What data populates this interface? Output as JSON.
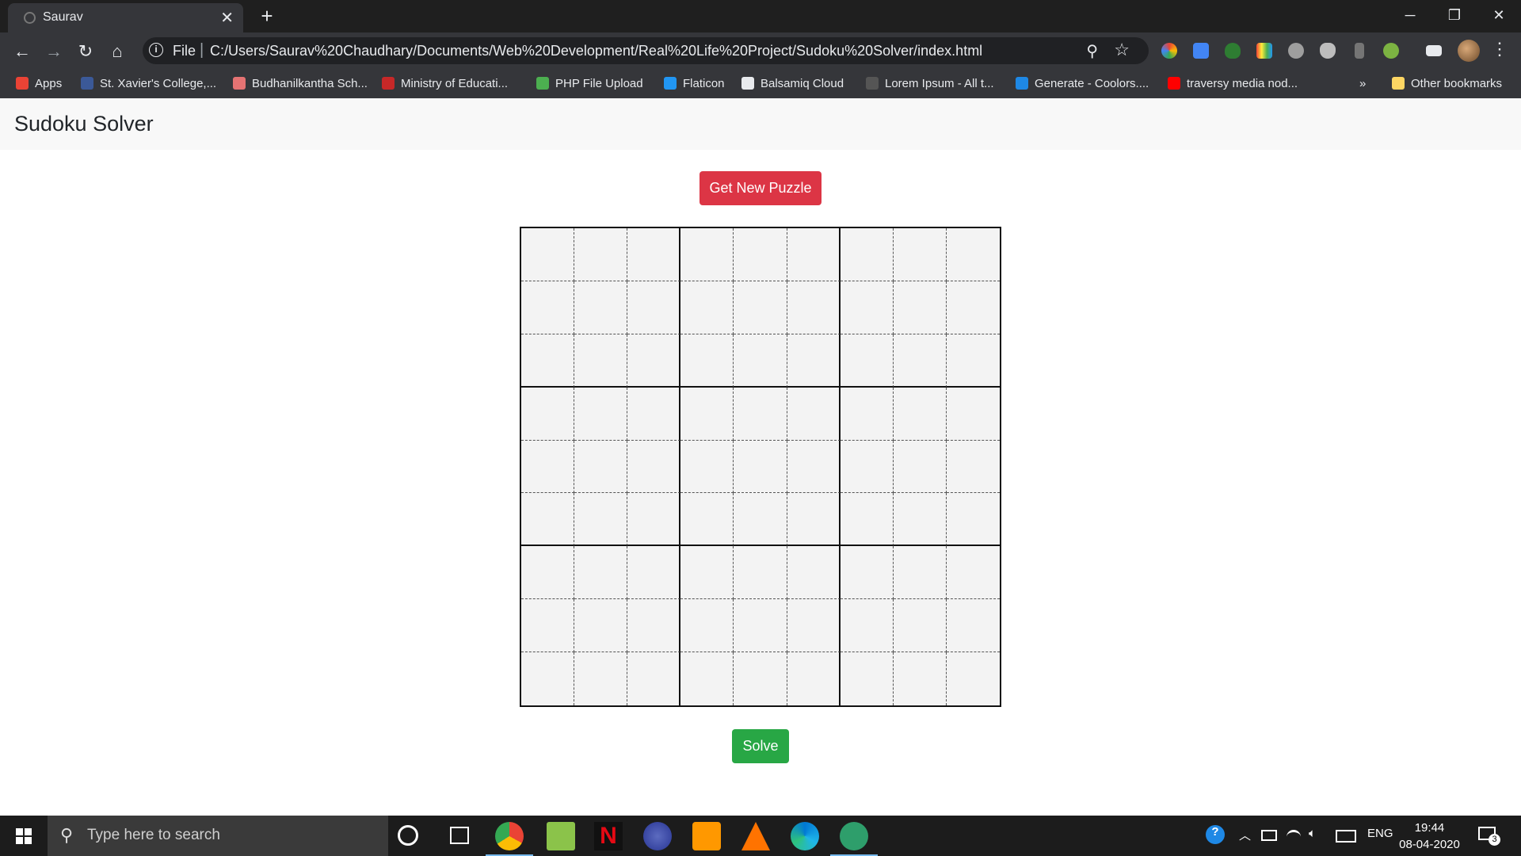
{
  "browser": {
    "tab_title": "Saurav",
    "tab_close": "✕",
    "new_tab": "+",
    "window_controls": [
      "─",
      "❐",
      "✕"
    ],
    "nav": {
      "back": "←",
      "forward": "→",
      "reload": "↻",
      "home": "⌂"
    },
    "omnibox": {
      "info": "i",
      "scheme": "File",
      "separator": "|",
      "url": "C:/Users/Saurav%20Chaudhary/Documents/Web%20Development/Real%20Life%20Project/Sudoku%20Solver/index.html",
      "zoom": "⚲",
      "star": "☆"
    },
    "menu": "⋮",
    "extensions": [
      "pinwheel-icon",
      "translate-icon",
      "shield-icon",
      "color-icon",
      "bulb-icon",
      "guard-icon",
      "bottle-icon",
      "tree-icon",
      "media-icon"
    ]
  },
  "bookmarks": {
    "items": [
      {
        "label": "Apps",
        "color": "#ea4335"
      },
      {
        "label": "St. Xavier's College,...",
        "color": "#3b5998"
      },
      {
        "label": "Budhanilkantha Sch...",
        "color": "#e57373"
      },
      {
        "label": "Ministry of Educati...",
        "color": "#c62828"
      },
      {
        "label": "PHP File Upload",
        "color": "#4caf50"
      },
      {
        "label": "Flaticon",
        "color": "#2196f3"
      },
      {
        "label": "Balsamiq Cloud",
        "color": "#e8eaed"
      },
      {
        "label": "Lorem Ipsum - All t...",
        "color": "#555555"
      },
      {
        "label": "Generate - Coolors....",
        "color": "#1e88e5"
      },
      {
        "label": "traversy media nod...",
        "color": "#ff0000"
      }
    ],
    "overflow": "»",
    "other": "Other bookmarks"
  },
  "page": {
    "brand": "Sudoku Solver",
    "new_puzzle_button": "Get New Puzzle",
    "solve_button": "Solve",
    "grid_size": 9,
    "colors": {
      "danger": "#dc3545",
      "success": "#28a745"
    }
  },
  "taskbar": {
    "search_placeholder": "Type here to search",
    "lang": "ENG",
    "time": "19:44",
    "date": "08-04-2020",
    "notification_count": "3"
  }
}
